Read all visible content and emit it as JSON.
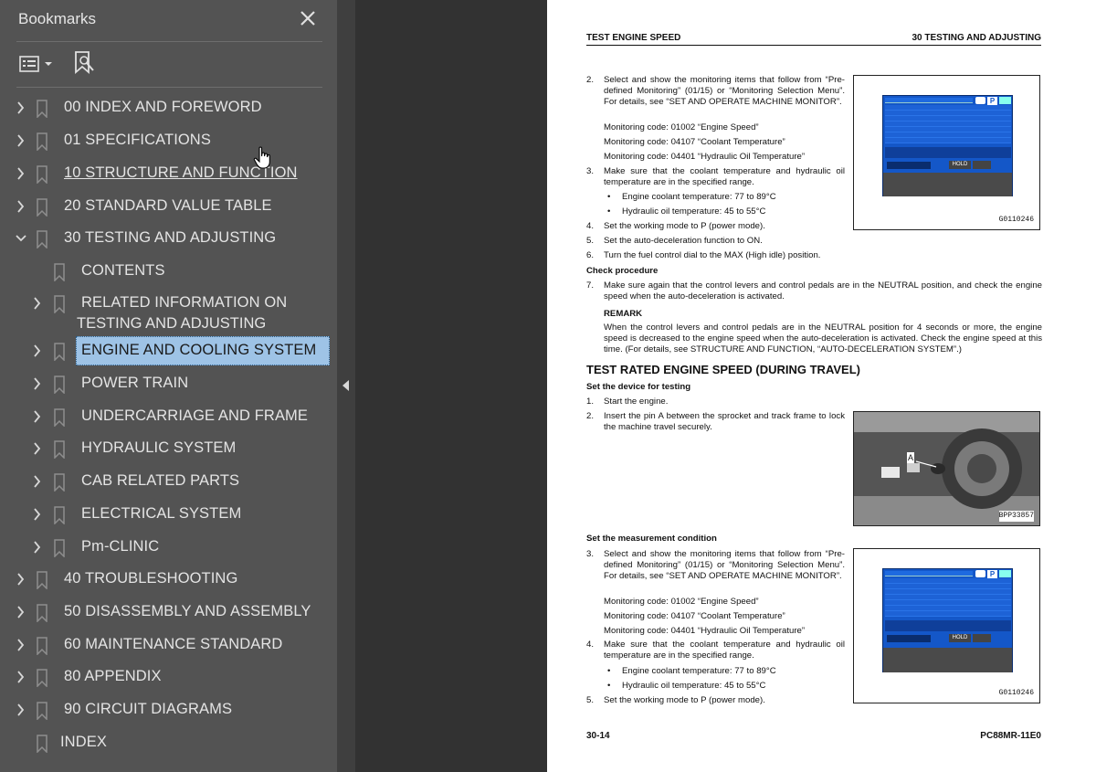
{
  "sidebar": {
    "title": "Bookmarks",
    "close_icon": "close-icon",
    "toolbar": {
      "options_icon": "options-menu-icon",
      "add_icon": "add-bookmark-icon"
    },
    "items": [
      {
        "label": "00 INDEX AND FOREWORD",
        "level": 0,
        "expandable": true,
        "expanded": false
      },
      {
        "label": "01 SPECIFICATIONS",
        "level": 0,
        "expandable": true,
        "expanded": false
      },
      {
        "label": " 10 STRUCTURE AND FUNCTION",
        "level": 0,
        "expandable": true,
        "expanded": false,
        "hover": true
      },
      {
        "label": "20 STANDARD VALUE TABLE",
        "level": 0,
        "expandable": true,
        "expanded": false
      },
      {
        "label": "30 TESTING AND ADJUSTING",
        "level": 0,
        "expandable": true,
        "expanded": true
      },
      {
        "label": "CONTENTS",
        "level": 1,
        "expandable": false
      },
      {
        "label": "RELATED INFORMATION ON",
        "label2": "TESTING AND ADJUSTING",
        "level": 1,
        "expandable": true
      },
      {
        "label": "ENGINE AND COOLING SYSTEM",
        "level": 1,
        "expandable": true,
        "selected": true
      },
      {
        "label": "POWER TRAIN",
        "level": 1,
        "expandable": true
      },
      {
        "label": "UNDERCARRIAGE AND FRAME",
        "level": 1,
        "expandable": true
      },
      {
        "label": "HYDRAULIC SYSTEM",
        "level": 1,
        "expandable": true
      },
      {
        "label": "CAB RELATED PARTS",
        "level": 1,
        "expandable": true
      },
      {
        "label": "ELECTRICAL SYSTEM",
        "level": 1,
        "expandable": true
      },
      {
        "label": "Pm-CLINIC",
        "level": 1,
        "expandable": true
      },
      {
        "label": "40 TROUBLESHOOTING",
        "level": 0,
        "expandable": true
      },
      {
        "label": "50 DISASSEMBLY AND ASSEMBLY",
        "level": 0,
        "expandable": true
      },
      {
        "label": "60 MAINTENANCE STANDARD",
        "level": 0,
        "expandable": true
      },
      {
        "label": "80 APPENDIX",
        "level": 0,
        "expandable": true
      },
      {
        "label": "90 CIRCUIT DIAGRAMS",
        "level": 0,
        "expandable": true
      },
      {
        "label": "INDEX",
        "level": 0,
        "expandable": false
      }
    ]
  },
  "page": {
    "header_left": "TEST ENGINE SPEED",
    "header_right": "30 TESTING AND ADJUSTING",
    "footer_left": "30-14",
    "footer_right": "PC88MR-11E0",
    "steps_a": [
      {
        "n": "2.",
        "text": "Select and show the monitoring items that follow from “Pre-defined Monitoring” (01/15) or “Monitoring Selection Menu”. For details, see “SET AND OPERATE MACHINE MONITOR”."
      },
      {
        "n": "",
        "text": "Monitoring code: 01002 “Engine Speed”"
      },
      {
        "n": "",
        "text": "Monitoring code: 04107 “Coolant Temperature”"
      },
      {
        "n": "",
        "text": "Monitoring code: 04401 “Hydraulic Oil Temperature”"
      },
      {
        "n": "3.",
        "text": "Make sure that the coolant temperature and hydraulic oil temperature are in the specified range."
      },
      {
        "n": "•",
        "text": "Engine coolant temperature: 77 to 89°C"
      },
      {
        "n": "•",
        "text": "Hydraulic oil temperature: 45 to 55°C"
      },
      {
        "n": "4.",
        "text": "Set the working mode to P (power mode)."
      },
      {
        "n": "5.",
        "text": "Set the auto-deceleration function to ON."
      },
      {
        "n": "6.",
        "text": "Turn the fuel control dial to the MAX (High idle) position."
      }
    ],
    "check_procedure": "Check procedure",
    "step7": "Make sure again that the control levers and control pedals are in the NEUTRAL position, and check the engine speed when the auto-deceleration is activated.",
    "step7_n": "7.",
    "remark_title": "REMARK",
    "remark_text": "When the control levers and control pedals are in the NEUTRAL position for 4 seconds or more, the engine speed is decreased to the engine speed when the auto-deceleration is activated. Check the engine speed at this time. (For details, see STRUCTURE AND FUNCTION, “AUTO-DECELERATION SYSTEM”.)",
    "section_title": "TEST RATED ENGINE SPEED (DURING TRAVEL)",
    "set_device": "Set the device for testing",
    "s1_n": "1.",
    "s1": "Start the engine.",
    "s2_n": "2.",
    "s2": "Insert the pin A between the sprocket and track frame to lock the machine travel securely.",
    "set_measure": "Set the measurement condition",
    "steps_b": [
      {
        "n": "3.",
        "text": "Select and show the monitoring items that follow from “Pre-defined Monitoring” (01/15) or “Monitoring Selection Menu”. For details, see “SET AND OPERATE MACHINE MONITOR”."
      },
      {
        "n": "",
        "text": "Monitoring code: 01002 “Engine Speed”"
      },
      {
        "n": "",
        "text": "Monitoring code: 04107 “Coolant Temperature”"
      },
      {
        "n": "",
        "text": "Monitoring code: 04401 “Hydraulic Oil Temperature”"
      },
      {
        "n": "4.",
        "text": "Make sure that the coolant temperature and hydraulic oil temperature are in the specified range."
      },
      {
        "n": "•",
        "text": "Engine coolant temperature: 77 to 89°C"
      },
      {
        "n": "•",
        "text": "Hydraulic oil temperature: 45 to 55°C"
      },
      {
        "n": "5.",
        "text": "Set the working mode to P (power mode)."
      }
    ],
    "fig1_caption": "G0110246",
    "fig2_caption": "BPP33857",
    "fig2_label": "A",
    "fig3_caption": "G0110246",
    "monitor_hold": "HOLD",
    "monitor_mode": "P"
  }
}
